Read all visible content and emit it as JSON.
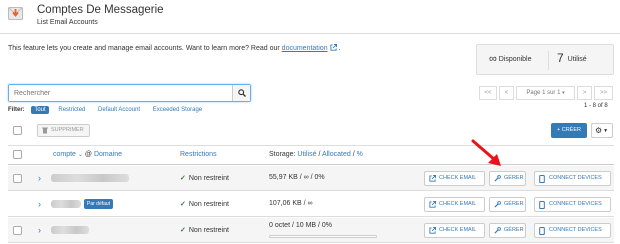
{
  "header": {
    "title": "Comptes De Messagerie",
    "subtitle": "List Email Accounts"
  },
  "intro": {
    "text": "This feature lets you create and manage email accounts. Want to learn more? Read our ",
    "link": "documentation",
    "suffix": "."
  },
  "stats": {
    "available_symbol": "∞",
    "available_label": "Disponible",
    "used_count": "7",
    "used_label": "Utilisé"
  },
  "search": {
    "placeholder": "Rechercher"
  },
  "pagination": {
    "first": "<<",
    "prev": "<",
    "page_label": "Page 1 sur 1",
    "next": ">",
    "last": ">>",
    "range": "1 - 8 of 8"
  },
  "filters": {
    "label": "Filter:",
    "options": [
      "Tout",
      "Restricted",
      "Default Account",
      "Exceeded Storage"
    ],
    "active": "Tout"
  },
  "toolbar": {
    "delete_label": "SUPPRIMER",
    "create_label": "+ CRÉER"
  },
  "table": {
    "col_account": "compte",
    "col_at": "@",
    "col_domain": "Domaine",
    "col_restrictions": "Restrictions",
    "col_storage_prefix": "Storage:",
    "col_storage_used": "Utilisé",
    "col_storage_allocated": "Allocated",
    "col_storage_pct": "%",
    "slash": "/",
    "rows": [
      {
        "badge": "",
        "restriction": "Non restreint",
        "storage": "55,97 KB / ∞ / 0%",
        "usage": 0
      },
      {
        "badge": "Par défaut",
        "restriction": "Non restreint",
        "storage": "107,06 KB / ∞",
        "usage": 0
      },
      {
        "badge": "",
        "restriction": "Non restreint",
        "storage": "0 octet / 10 MB / 0%",
        "usage": 0
      }
    ],
    "action_check": "CHECK EMAIL",
    "action_manage": "GÉRER",
    "action_devices": "CONNECT DEVICES"
  },
  "colors": {
    "accent": "#337ab7",
    "success": "#3c763d",
    "annotation_arrow": "#e8141b"
  }
}
